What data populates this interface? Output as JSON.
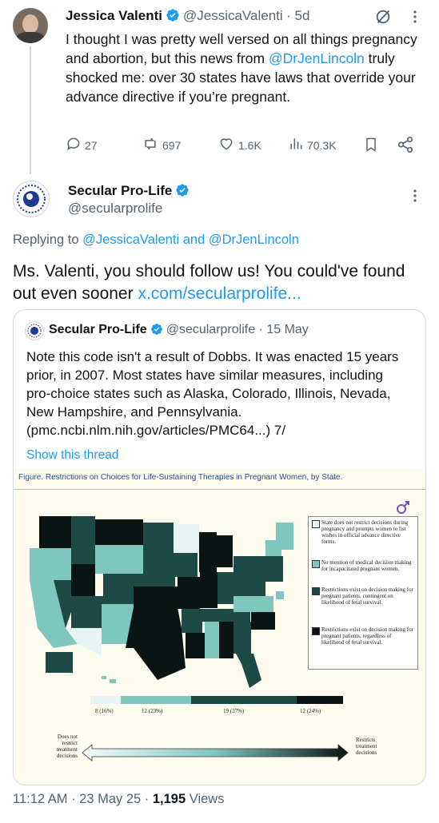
{
  "tweet1": {
    "name": "Jessica Valenti",
    "handle": "@JessicaValenti",
    "time": "· 5d",
    "text_before": "I thought I was pretty well versed on all things pregnancy and abortion, but this news from ",
    "mention": "@DrJenLincoln",
    "text_after": " truly shocked me: over 30 states have laws that override your advance directive if you’re pregnant.",
    "actions": {
      "replies": "27",
      "reposts": "697",
      "likes": "1.6K",
      "views": "70.3K"
    }
  },
  "tweet2": {
    "name": "Secular Pro-Life",
    "handle": "@secularprolife",
    "replying_prefix": "Replying to ",
    "replying_to": "@JessicaValenti and @DrJenLincoln",
    "text": "Ms. Valenti, you should follow us! You could've found out even sooner ",
    "link": "x.com/secularprolife...",
    "footer_time": "11:12 AM · 23 May 25 · ",
    "footer_views": "1,195",
    "footer_views_label": " Views"
  },
  "quote": {
    "name": "Secular Pro-Life",
    "handle": "@secularprolife",
    "time": "· 15 May",
    "text": "Note this code isn't a result of Dobbs. It was enacted 15 years prior, in 2007. Most states have similar measures, including pro-choice states such as Alaska, Colorado, Illinois, Nevada, New Hampshire, and Pennsylvania. (pmc.ncbi.nlm.nih.gov/articles/PMC64...) 7/",
    "show_thread": "Show this thread"
  },
  "figure": {
    "title": "Figure. Restrictions on Choices for Life-Sustaining Therapies in Pregnant Women, by State.",
    "legend": [
      {
        "label": "State does not restrict decisions during pregnancy and prompts women to list wishes in official advance directive forms.",
        "color": "#e8f4f3"
      },
      {
        "label": "No mention of medical decision making for incapacitated pregnant women.",
        "color": "#7fc6be"
      },
      {
        "label": "Restrictions exist on decision making for pregnant patients, contingent on likelihood of fetal survival.",
        "color": "#1d4a45"
      },
      {
        "label": "Restrictions exist on decision making for pregnant patients, regardless of likelihood of fetal survival.",
        "color": "#0a1513"
      }
    ],
    "bar_labels": [
      "8 (16%)",
      "12 (23%)",
      "19 (37%)",
      "12 (24%)"
    ],
    "scale_left": "Does not restrict treatment decisions",
    "scale_right": "Restricts treatment decisions"
  },
  "colors": {
    "accent": "#1d9bf0",
    "muted": "#536471",
    "verified": "#1d9bf0"
  }
}
